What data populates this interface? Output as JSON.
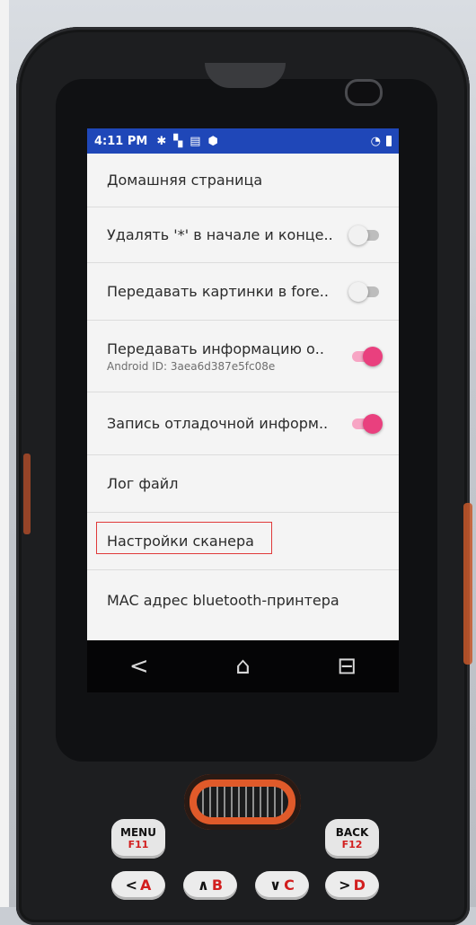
{
  "status_bar": {
    "time": "4:11 PM",
    "icons": [
      "gear-icon",
      "grid-icon",
      "barcode-icon",
      "shield-icon"
    ],
    "right_icons": [
      "wifi-icon",
      "battery-icon"
    ]
  },
  "settings": [
    {
      "label": "Домашняя страница",
      "toggle": null
    },
    {
      "label": "Удалять '*' в начале и конце..",
      "toggle": "off"
    },
    {
      "label": "Передавать картинки в fore..",
      "toggle": "off"
    },
    {
      "label": "Передавать информацию о..",
      "sublabel": "Android ID: 3aea6d387e5fc08e",
      "toggle": "on"
    },
    {
      "label": "Запись отладочной информ..",
      "toggle": "on"
    },
    {
      "label": "Лог файл",
      "toggle": null
    },
    {
      "label": "Настройки сканера",
      "toggle": null,
      "highlighted": true
    },
    {
      "label": "MAC адрес bluetooth-принтера",
      "toggle": null
    }
  ],
  "nav": {
    "back": "<",
    "home": "⌂",
    "recent": "⊟"
  },
  "hardware": {
    "menu_key": "MENU",
    "menu_sub": "F11",
    "back_key": "BACK",
    "back_sub": "F12",
    "key_a": {
      "arrow": "<",
      "letter": "A"
    },
    "key_b": {
      "arrow": "∧",
      "letter": "B"
    },
    "key_c": {
      "arrow": "∨",
      "letter": "C"
    },
    "key_d": {
      "arrow": ">",
      "letter": "D"
    }
  },
  "colors": {
    "status_bar": "#1f47b8",
    "toggle_on": "#e9407e",
    "highlight_border": "#e03a3a"
  }
}
